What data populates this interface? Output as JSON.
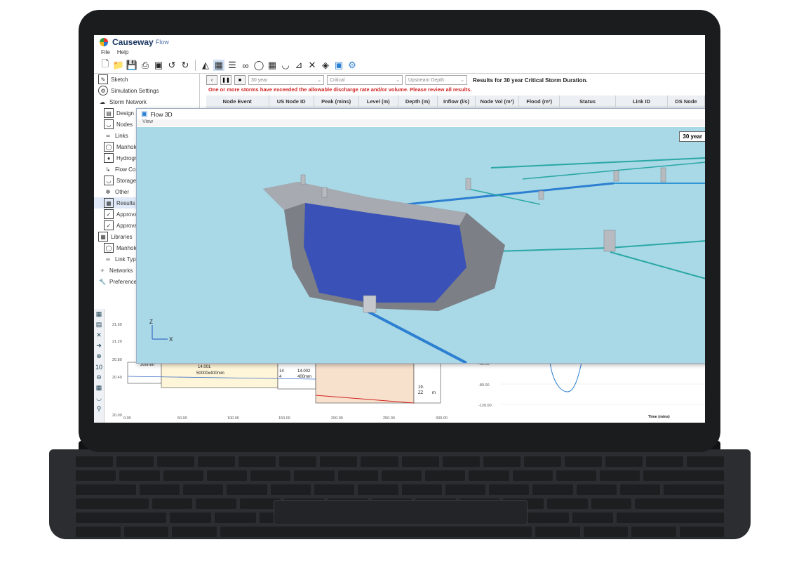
{
  "app": {
    "name": "Causeway",
    "sub": "Flow"
  },
  "menu": [
    "File",
    "Help"
  ],
  "toolbar_icons": [
    "new-file-icon",
    "open-folder-icon",
    "save-icon",
    "print-icon",
    "print-preview-icon",
    "undo-icon",
    "redo-icon",
    "manhole-icon",
    "profile-icon",
    "list-icon",
    "link-icon",
    "flow-control-icon",
    "table-icon",
    "storage-icon",
    "chart-icon",
    "tools-icon",
    "model-icon",
    "3d-box-icon",
    "settings-gear-icon"
  ],
  "sidebar": {
    "items": [
      {
        "label": "Sketch",
        "level": 0
      },
      {
        "label": "Simulation Settings",
        "level": 0
      },
      {
        "label": "Storm Network",
        "level": 0
      },
      {
        "label": "Design",
        "level": 1
      },
      {
        "label": "Nodes",
        "level": 1
      },
      {
        "label": "Links",
        "level": 1
      },
      {
        "label": "Manhole",
        "level": 1
      },
      {
        "label": "Hydrograph",
        "level": 1
      },
      {
        "label": "Flow Co",
        "level": 1
      },
      {
        "label": "Storage",
        "level": 1
      },
      {
        "label": "Other",
        "level": 1
      },
      {
        "label": "Results",
        "level": 1
      },
      {
        "label": "Approva",
        "level": 1
      },
      {
        "label": "Approva",
        "level": 1
      },
      {
        "label": "Libraries",
        "level": 0
      },
      {
        "label": "Manhole",
        "level": 1
      },
      {
        "label": "Link Typ",
        "level": 1
      },
      {
        "label": "Networks",
        "level": 0
      },
      {
        "label": "Preference",
        "level": 0
      }
    ]
  },
  "results": {
    "storm": "30 year",
    "duration": "Critical",
    "mode": "Upstream Depth",
    "title": "Results for 30 year Critical Storm Duration.",
    "warning": "One or more storms have exceeded the allowable discharge rate and/or volume.  Please review all results.",
    "columns": [
      "Node Event",
      "US Node ID",
      "Peak (mins)",
      "Level (m)",
      "Depth (m)",
      "Inflow (l/s)",
      "Node Vol (m³)",
      "Flood (m³)",
      "Status",
      "Link ID",
      "DS Node"
    ]
  },
  "flow3d": {
    "title": "Flow 3D",
    "menu": "View",
    "storm_label": "30 year",
    "axis_z": "Z",
    "axis_x": "X"
  },
  "profile": {
    "y_ticks": [
      "21.60",
      "21.20",
      "20.80",
      "20.40",
      "20.00"
    ],
    "x_ticks": [
      "0.00",
      "50.00",
      "100.00",
      "150.00",
      "200.00",
      "250.00",
      "300.00"
    ],
    "labels": [
      "300mm",
      "14.001",
      "50000x400mm",
      "14",
      "4",
      "14.002",
      "400mm",
      "19.",
      "ZZ",
      "m"
    ],
    "chart_y_ticks": [
      "-60.00",
      "-80.00",
      "-120.00"
    ],
    "chart_xlabel": "Time (mins)",
    "zoom": "10"
  },
  "colors": {
    "warning": "#d12222",
    "viewport": "#a9d8e6",
    "pipe": "#2c7fd1",
    "storage_water": "#3a52b8"
  }
}
